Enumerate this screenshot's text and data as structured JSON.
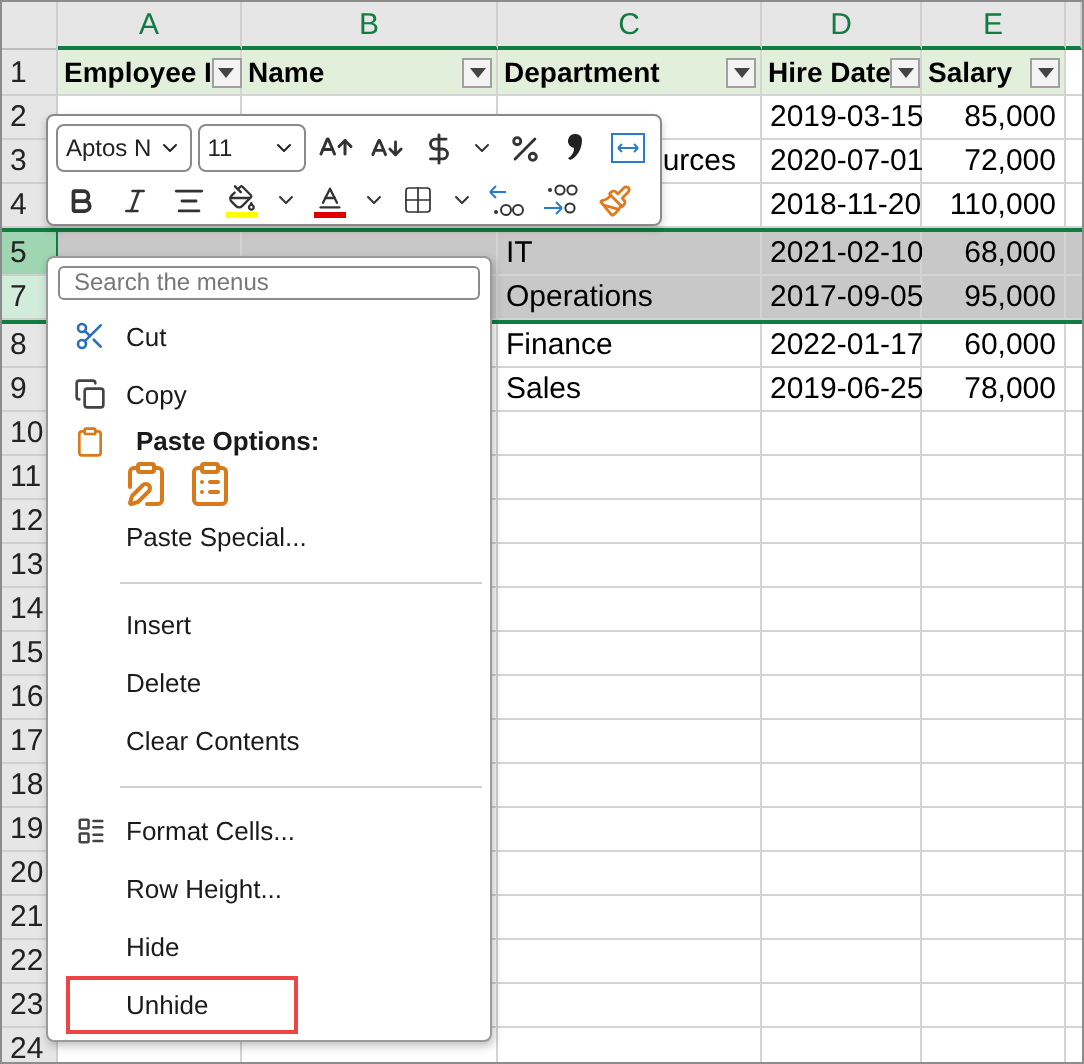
{
  "columns": [
    "A",
    "B",
    "C",
    "D",
    "E"
  ],
  "header_row": {
    "number": "1",
    "cells": [
      {
        "label": "Employee I",
        "filter": true
      },
      {
        "label": "Name",
        "filter": true
      },
      {
        "label": "Department",
        "filter": true
      },
      {
        "label": "Hire Date",
        "filter": true
      },
      {
        "label": "Salary",
        "filter": true
      }
    ]
  },
  "rows": [
    {
      "number": "2",
      "selected": false,
      "active": false,
      "hire_date": "2019-03-15",
      "salary": "85,000"
    },
    {
      "number": "3",
      "selected": false,
      "active": false,
      "department_tail": "urces",
      "hire_date": "2020-07-01",
      "salary": "72,000"
    },
    {
      "number": "4",
      "selected": false,
      "active": false,
      "hire_date": "2018-11-20",
      "salary": "110,000"
    },
    {
      "number": "5",
      "selected": true,
      "active": true,
      "department": "IT",
      "hire_date": "2021-02-10",
      "salary": "68,000"
    },
    {
      "number": "7",
      "selected": true,
      "active": false,
      "department": "Operations",
      "hire_date": "2017-09-05",
      "salary": "95,000"
    },
    {
      "number": "8",
      "selected": false,
      "active": false,
      "department": "Finance",
      "hire_date": "2022-01-17",
      "salary": "60,000"
    },
    {
      "number": "9",
      "selected": false,
      "active": false,
      "department": "Sales",
      "hire_date": "2019-06-25",
      "salary": "78,000"
    },
    {
      "number": "10",
      "selected": false,
      "active": false
    },
    {
      "number": "11",
      "selected": false,
      "active": false
    },
    {
      "number": "12",
      "selected": false,
      "active": false
    },
    {
      "number": "13",
      "selected": false,
      "active": false
    },
    {
      "number": "14",
      "selected": false,
      "active": false
    },
    {
      "number": "15",
      "selected": false,
      "active": false
    },
    {
      "number": "16",
      "selected": false,
      "active": false
    },
    {
      "number": "17",
      "selected": false,
      "active": false
    },
    {
      "number": "18",
      "selected": false,
      "active": false
    },
    {
      "number": "19",
      "selected": false,
      "active": false
    },
    {
      "number": "20",
      "selected": false,
      "active": false
    },
    {
      "number": "21",
      "selected": false,
      "active": false
    },
    {
      "number": "22",
      "selected": false,
      "active": false
    },
    {
      "number": "23",
      "selected": false,
      "active": false
    },
    {
      "number": "24",
      "selected": false,
      "active": false
    }
  ],
  "mini_toolbar": {
    "font": "Aptos N",
    "size": "11"
  },
  "context_menu": {
    "search": {
      "placeholder": "Search the menus"
    },
    "items": [
      {
        "kind": "command",
        "label": "Cut",
        "highlighted": false
      },
      {
        "kind": "command",
        "label": "Copy",
        "highlighted": false
      },
      {
        "kind": "heading",
        "label": "Paste Options:"
      },
      {
        "kind": "paste-icons"
      },
      {
        "kind": "command",
        "label": "Paste Special...",
        "highlighted": false
      },
      {
        "kind": "separator"
      },
      {
        "kind": "command",
        "label": "Insert",
        "highlighted": false
      },
      {
        "kind": "command",
        "label": "Delete",
        "highlighted": false
      },
      {
        "kind": "command",
        "label": "Clear Contents",
        "highlighted": false
      },
      {
        "kind": "separator"
      },
      {
        "kind": "command",
        "label": "Format Cells...",
        "highlighted": false
      },
      {
        "kind": "command",
        "label": "Row Height...",
        "highlighted": false
      },
      {
        "kind": "command",
        "label": "Hide",
        "highlighted": false
      },
      {
        "kind": "command",
        "label": "Unhide",
        "highlighted": true
      }
    ]
  }
}
